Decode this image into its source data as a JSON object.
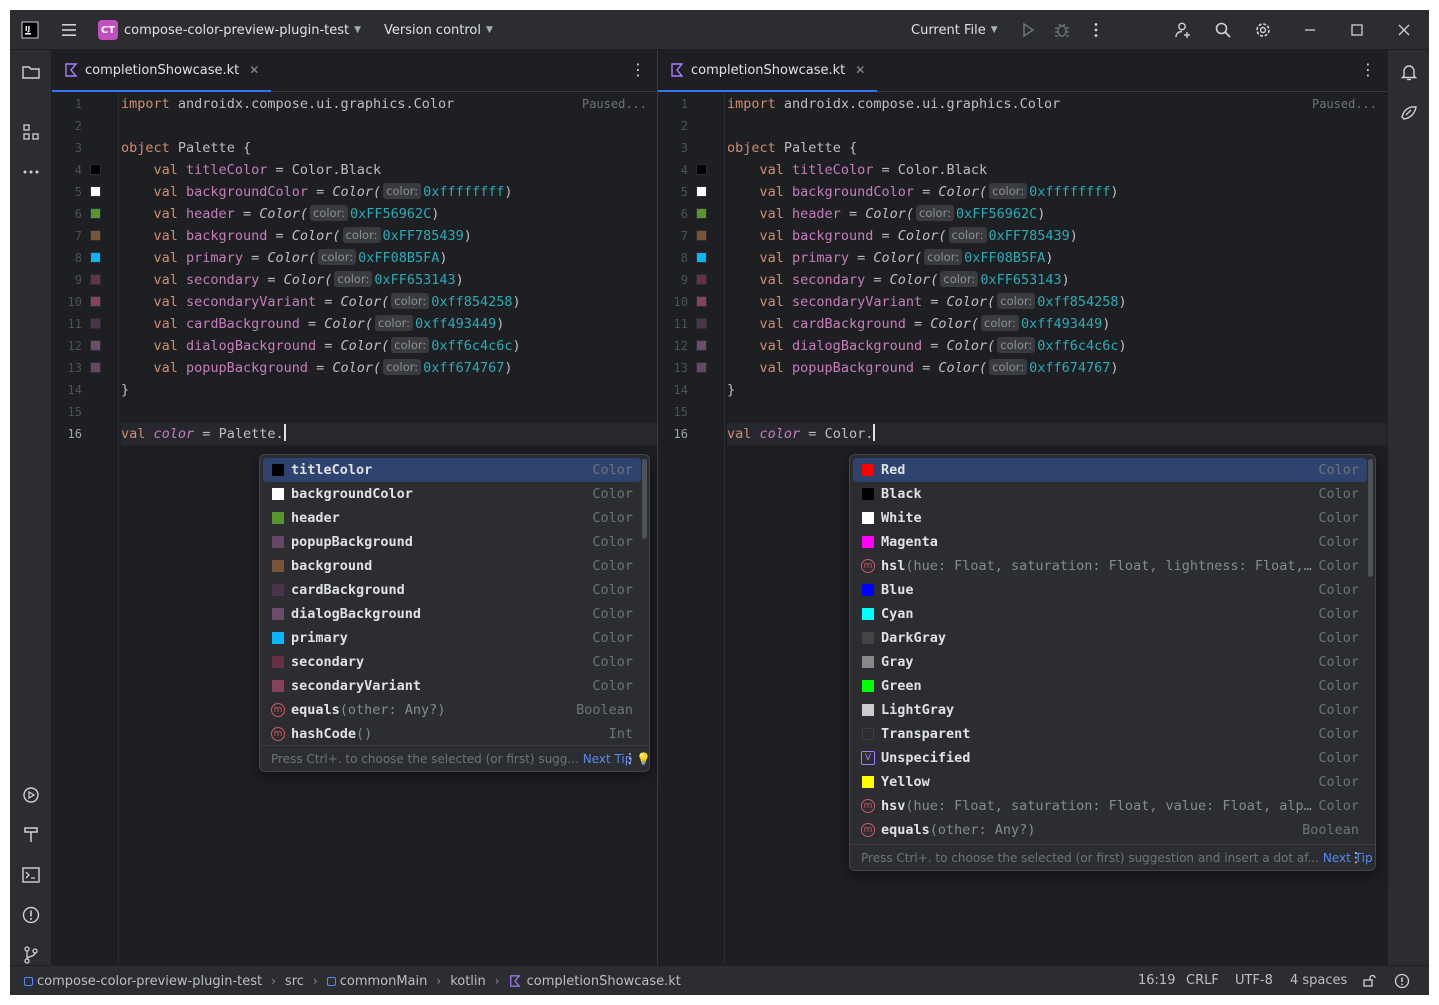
{
  "titlebar": {
    "project_badge": "CT",
    "project_name": "compose-color-preview-plugin-test",
    "vcs": "Version control",
    "run_config": "Current File"
  },
  "tabs": {
    "left": {
      "filename": "completionShowcase.kt"
    },
    "right": {
      "filename": "completionShowcase.kt"
    }
  },
  "editor": {
    "paused": "Paused...",
    "line_numbers": [
      "1",
      "2",
      "3",
      "4",
      "5",
      "6",
      "7",
      "8",
      "9",
      "10",
      "11",
      "12",
      "13",
      "14",
      "15",
      "16"
    ],
    "import_kw": "import",
    "import_path": "androidx.compose.ui.graphics.Color",
    "object_kw": "object",
    "object_name": "Palette {",
    "val_kw": "val",
    "eq": " = ",
    "color_ctor": "Color(",
    "hint": "color:",
    "close_brace": "}",
    "props": [
      {
        "name": "titleColor",
        "value": "Color.Black",
        "swatch": "#000000"
      },
      {
        "name": "backgroundColor",
        "value": "0xffffffff",
        "swatch": "#ffffff"
      },
      {
        "name": "header",
        "value": "0xFF56962C",
        "swatch": "#56962c"
      },
      {
        "name": "background",
        "value": "0xFF785439",
        "swatch": "#785439"
      },
      {
        "name": "primary",
        "value": "0xFF08B5FA",
        "swatch": "#08b5fa"
      },
      {
        "name": "secondary",
        "value": "0xFF653143",
        "swatch": "#653143"
      },
      {
        "name": "secondaryVariant",
        "value": "0xff854258",
        "swatch": "#854258"
      },
      {
        "name": "cardBackground",
        "value": "0xff493449",
        "swatch": "#493449"
      },
      {
        "name": "dialogBackground",
        "value": "0xff6c4c6c",
        "swatch": "#6c4c6c"
      },
      {
        "name": "popupBackground",
        "value": "0xff674767",
        "swatch": "#674767"
      }
    ],
    "left_last": {
      "kw": "val",
      "name": "color",
      "rhs": "Palette."
    },
    "right_last": {
      "kw": "val",
      "name": "color",
      "rhs": "Color."
    }
  },
  "popup_left": {
    "items": [
      {
        "name": "titleColor",
        "params": "",
        "type": "Color",
        "swatch": "#000000",
        "icon": ""
      },
      {
        "name": "backgroundColor",
        "params": "",
        "type": "Color",
        "swatch": "#ffffff",
        "icon": ""
      },
      {
        "name": "header",
        "params": "",
        "type": "Color",
        "swatch": "#56962c",
        "icon": ""
      },
      {
        "name": "popupBackground",
        "params": "",
        "type": "Color",
        "swatch": "#674767",
        "icon": ""
      },
      {
        "name": "background",
        "params": "",
        "type": "Color",
        "swatch": "#785439",
        "icon": ""
      },
      {
        "name": "cardBackground",
        "params": "",
        "type": "Color",
        "swatch": "#493449",
        "icon": ""
      },
      {
        "name": "dialogBackground",
        "params": "",
        "type": "Color",
        "swatch": "#6c4c6c",
        "icon": ""
      },
      {
        "name": "primary",
        "params": "",
        "type": "Color",
        "swatch": "#08b5fa",
        "icon": ""
      },
      {
        "name": "secondary",
        "params": "",
        "type": "Color",
        "swatch": "#653143",
        "icon": ""
      },
      {
        "name": "secondaryVariant",
        "params": "",
        "type": "Color",
        "swatch": "#854258",
        "icon": ""
      },
      {
        "name": "equals",
        "params": "(other: Any?)",
        "type": "Boolean",
        "swatch": "",
        "icon": "method-icon"
      },
      {
        "name": "hashCode",
        "params": "()",
        "type": "Int",
        "swatch": "",
        "icon": "method-icon"
      }
    ],
    "footer_text": "Press Ctrl+. to choose the selected (or first) sugg...",
    "next_tip": "Next Tip"
  },
  "popup_right": {
    "items": [
      {
        "name": "Red",
        "params": "",
        "type": "Color",
        "swatch": "#ff0000",
        "icon": ""
      },
      {
        "name": "Black",
        "params": "",
        "type": "Color",
        "swatch": "#000000",
        "icon": ""
      },
      {
        "name": "White",
        "params": "",
        "type": "Color",
        "swatch": "#ffffff",
        "icon": ""
      },
      {
        "name": "Magenta",
        "params": "",
        "type": "Color",
        "swatch": "#ff00ff",
        "icon": ""
      },
      {
        "name": "hsl",
        "params": "(hue: Float, saturation: Float, lightness: Float,…",
        "type": "Color",
        "swatch": "",
        "icon": "method-icon"
      },
      {
        "name": "Blue",
        "params": "",
        "type": "Color",
        "swatch": "#0000ff",
        "icon": ""
      },
      {
        "name": "Cyan",
        "params": "",
        "type": "Color",
        "swatch": "#00ffff",
        "icon": ""
      },
      {
        "name": "DarkGray",
        "params": "",
        "type": "Color",
        "swatch": "#444444",
        "icon": ""
      },
      {
        "name": "Gray",
        "params": "",
        "type": "Color",
        "swatch": "#888888",
        "icon": ""
      },
      {
        "name": "Green",
        "params": "",
        "type": "Color",
        "swatch": "#00ff00",
        "icon": ""
      },
      {
        "name": "LightGray",
        "params": "",
        "type": "Color",
        "swatch": "#cccccc",
        "icon": ""
      },
      {
        "name": "Transparent",
        "params": "",
        "type": "Color",
        "swatch": "#2b2d30",
        "icon": ""
      },
      {
        "name": "Unspecified",
        "params": "",
        "type": "Color",
        "swatch": "",
        "icon": "variable-icon"
      },
      {
        "name": "Yellow",
        "params": "",
        "type": "Color",
        "swatch": "#ffff00",
        "icon": ""
      },
      {
        "name": "hsv",
        "params": "(hue: Float, saturation: Float, value: Float, alp…",
        "type": "Color",
        "swatch": "",
        "icon": "method-icon"
      },
      {
        "name": "equals",
        "params": "(other: Any?)",
        "type": "Boolean",
        "swatch": "",
        "icon": "method-icon"
      }
    ],
    "footer_text": "Press Ctrl+. to choose the selected (or first) suggestion and insert a dot af...",
    "next_tip": "Next Tip"
  },
  "statusbar": {
    "breadcrumbs": [
      "compose-color-preview-plugin-test",
      "src",
      "commonMain",
      "kotlin",
      "completionShowcase.kt"
    ],
    "position": "16:19",
    "line_sep": "CRLF",
    "encoding": "UTF-8",
    "indent": "4 spaces"
  }
}
